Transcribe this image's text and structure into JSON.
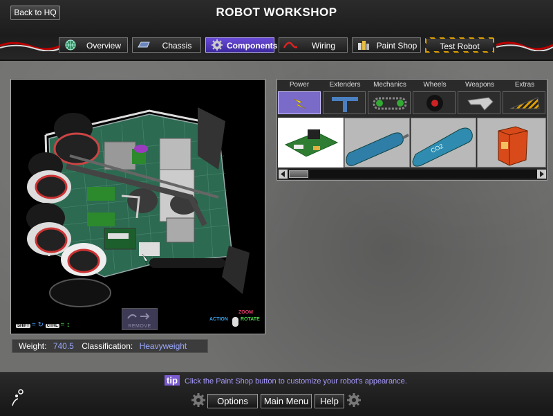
{
  "header": {
    "back_label": "Back to HQ",
    "title": "ROBOT WORKSHOP"
  },
  "tabs": [
    {
      "label": "Overview",
      "icon": "globe-icon"
    },
    {
      "label": "Chassis",
      "icon": "chassis-icon"
    },
    {
      "label": "Components",
      "icon": "gear-icon",
      "active": true
    },
    {
      "label": "Wiring",
      "icon": "wire-icon"
    },
    {
      "label": "Paint Shop",
      "icon": "paint-cans-icon"
    },
    {
      "label": "Test Robot",
      "icon": "hazard-stripes"
    }
  ],
  "viewport": {
    "remove_label": "REMOVE",
    "hints": {
      "shift": "SHIFT",
      "ctrl": "CTRL",
      "zoom": "ZOOM",
      "action": "ACTION",
      "rotate": "ROTATE"
    }
  },
  "info": {
    "weight_label": "Weight:",
    "weight_value": "740.5",
    "class_label": "Classification:",
    "class_value": "Heavyweight"
  },
  "parts": {
    "categories": [
      {
        "label": "Power",
        "icon": "lightning-icon",
        "active": true
      },
      {
        "label": "Extenders",
        "icon": "t-connector-icon"
      },
      {
        "label": "Mechanics",
        "icon": "chain-icon"
      },
      {
        "label": "Wheels",
        "icon": "wheel-icon"
      },
      {
        "label": "Weapons",
        "icon": "blade-icon"
      },
      {
        "label": "Extras",
        "icon": "wedge-icon"
      }
    ],
    "items": [
      {
        "name": "circuit-board",
        "selected": true
      },
      {
        "name": "blue-tank"
      },
      {
        "name": "co2-tank",
        "label": "CO2"
      },
      {
        "name": "orange-box"
      }
    ]
  },
  "bottom": {
    "tip_badge": "tip",
    "tip_text": "Click the Paint Shop button to customize your robot's appearance.",
    "options_label": "Options",
    "main_menu_label": "Main Menu",
    "help_label": "Help"
  },
  "colors": {
    "accent": "#6a4bd8",
    "value_text": "#9aa8ff",
    "tip_text": "#a89bff"
  }
}
